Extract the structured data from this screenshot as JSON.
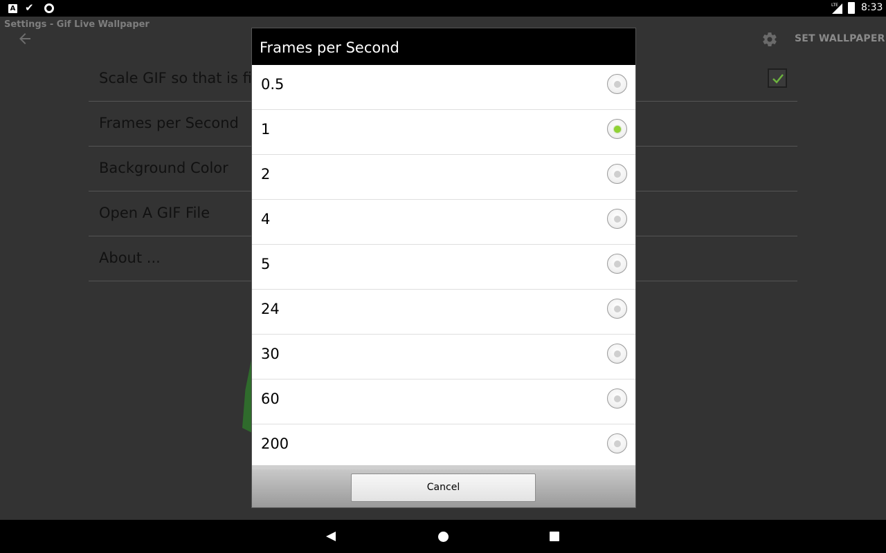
{
  "status_bar": {
    "time": "8:33",
    "notification_icons": [
      "a-box-icon",
      "check-icon",
      "circle-icon"
    ],
    "system_icons": [
      "lte-signal-icon",
      "battery-charging-icon"
    ]
  },
  "app_bar": {
    "title": "Settings - Gif Live Wallpaper",
    "back_icon": "back-arrow-icon",
    "settings_icon": "gear-icon",
    "set_wallpaper_label": "SET WALLPAPER"
  },
  "preferences": [
    {
      "label": "Scale GIF so that is fits"
    },
    {
      "label": "Frames per Second"
    },
    {
      "label": "Background Color"
    },
    {
      "label": "Open A GIF File"
    },
    {
      "label": "About ..."
    }
  ],
  "dialog": {
    "title": "Frames per Second",
    "options": [
      {
        "label": "0.5",
        "checked": false
      },
      {
        "label": "1",
        "checked": true
      },
      {
        "label": "2",
        "checked": false
      },
      {
        "label": "4",
        "checked": false
      },
      {
        "label": "5",
        "checked": false
      },
      {
        "label": "24",
        "checked": false
      },
      {
        "label": "30",
        "checked": false
      },
      {
        "label": "60",
        "checked": false
      },
      {
        "label": "200",
        "checked": false
      }
    ],
    "cancel_label": "Cancel"
  },
  "colors": {
    "radio_checked": "#8fd233",
    "checkbox_check": "#6db33f",
    "background": "#333333"
  }
}
